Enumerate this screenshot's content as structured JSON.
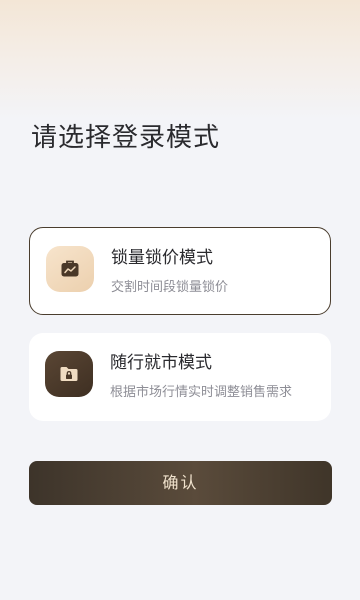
{
  "page": {
    "title": "请选择登录模式"
  },
  "modes": [
    {
      "title": "锁量锁价模式",
      "description": "交割时间段锁量锁价",
      "icon": "briefcase-chart-icon",
      "selected": true
    },
    {
      "title": "随行就市模式",
      "description": "根据市场行情实时调整销售需求",
      "icon": "folder-lock-icon",
      "selected": false
    }
  ],
  "confirm_label": "确认",
  "colors": {
    "background": "#f3f4f8",
    "accent_dark": "#4a3d2e",
    "accent_light": "#ecd0ae",
    "button_text": "#f0e2cd"
  }
}
